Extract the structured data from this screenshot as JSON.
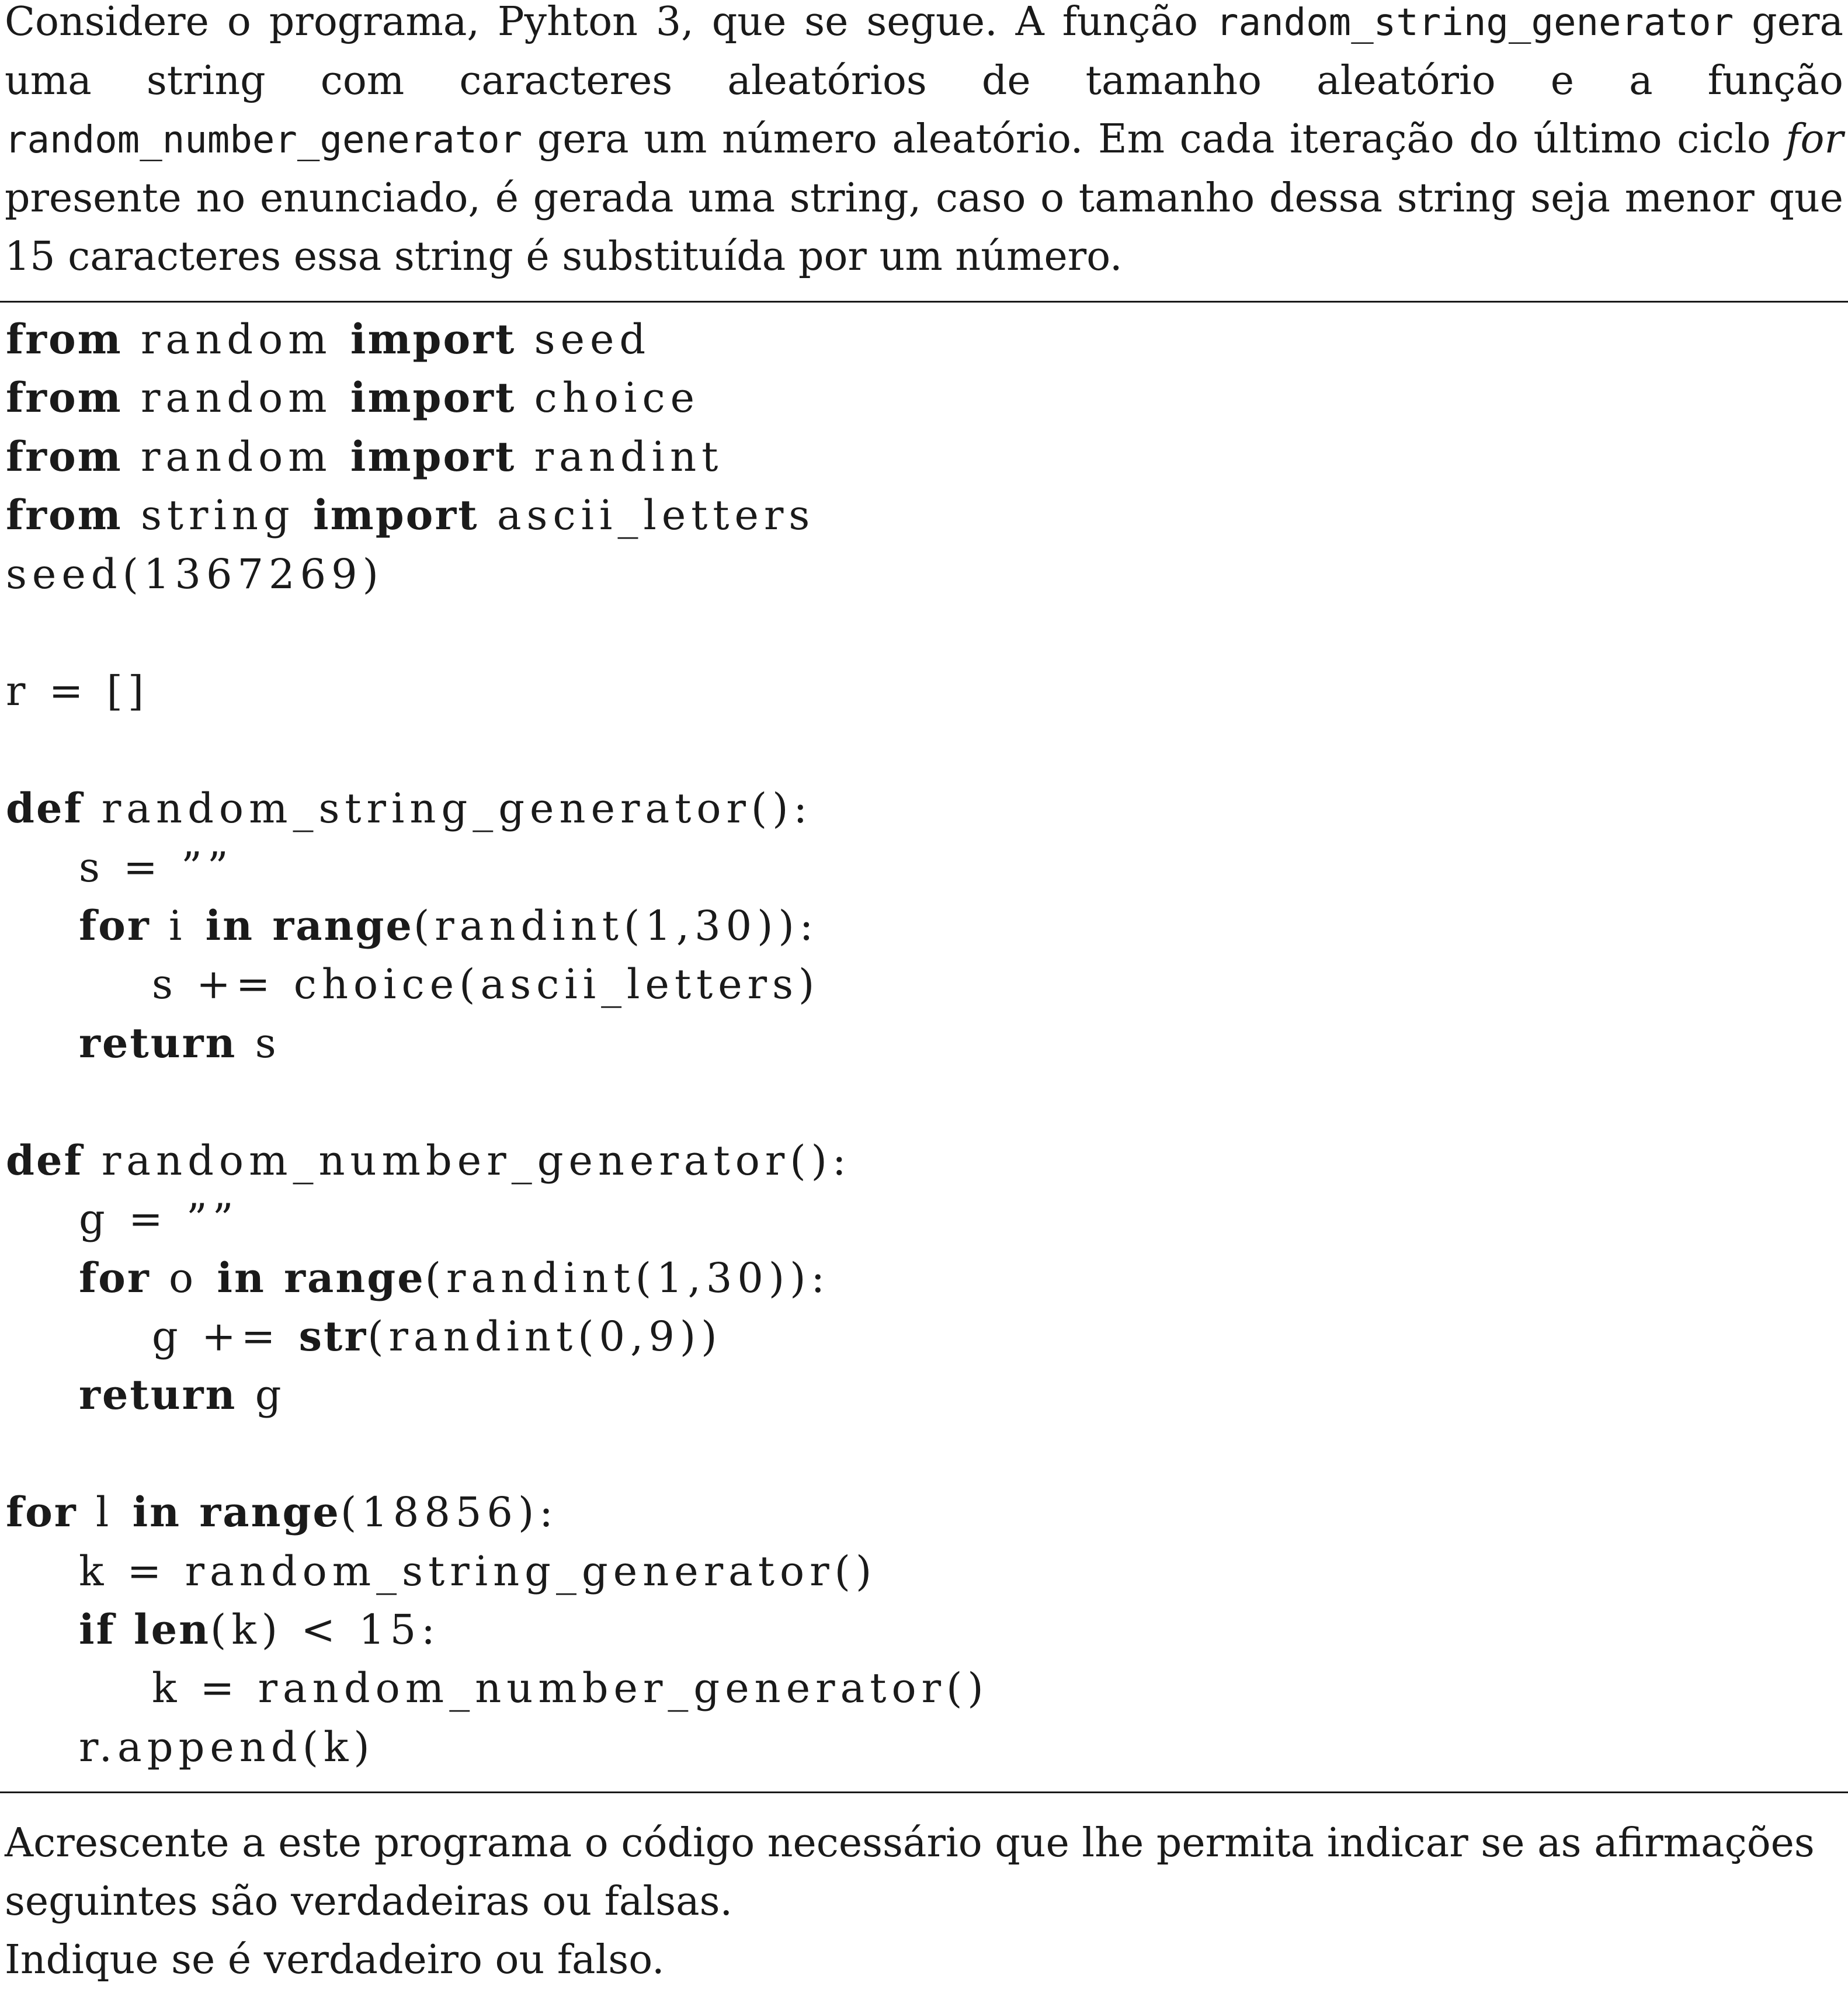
{
  "intro": {
    "text_1": "Considere o programa, Pyhton 3, que se segue.  A função ",
    "func_1": "random_string_generator",
    "text_2": " gera uma string com caracteres aleatórios de tamanho aleatório e a função ",
    "func_2": "random_number_generator",
    "text_3": " gera um número aleatório. Em cada iteração do último ciclo ",
    "for_word": "for",
    "text_4": " presente no enunciado, é gerada uma string, caso o tamanho dessa string seja menor que 15 caracteres essa string é substituída por um número."
  },
  "code": {
    "lines": [
      [
        {
          "t": "from",
          "k": true
        },
        {
          "t": " random "
        },
        {
          "t": "import",
          "k": true
        },
        {
          "t": " seed"
        }
      ],
      [
        {
          "t": "from",
          "k": true
        },
        {
          "t": " random "
        },
        {
          "t": "import",
          "k": true
        },
        {
          "t": " choice"
        }
      ],
      [
        {
          "t": "from",
          "k": true
        },
        {
          "t": " random "
        },
        {
          "t": "import",
          "k": true
        },
        {
          "t": " randint"
        }
      ],
      [
        {
          "t": "from",
          "k": true
        },
        {
          "t": " string "
        },
        {
          "t": "import",
          "k": true
        },
        {
          "t": " ascii_letters"
        }
      ],
      [
        {
          "t": "seed(1367269)"
        }
      ],
      [],
      [
        {
          "t": "r = []"
        }
      ],
      [],
      [
        {
          "t": "def",
          "k": true
        },
        {
          "t": " random_string_generator():"
        }
      ],
      [
        {
          "t": "    s = ””"
        }
      ],
      [
        {
          "t": "    "
        },
        {
          "t": "for",
          "k": true
        },
        {
          "t": " i "
        },
        {
          "t": "in",
          "k": true
        },
        {
          "t": " "
        },
        {
          "t": "range",
          "k": true
        },
        {
          "t": "(randint(1,30)):"
        }
      ],
      [
        {
          "t": "        s += choice(ascii_letters)"
        }
      ],
      [
        {
          "t": "    "
        },
        {
          "t": "return",
          "k": true
        },
        {
          "t": " s"
        }
      ],
      [],
      [
        {
          "t": "def",
          "k": true
        },
        {
          "t": " random_number_generator():"
        }
      ],
      [
        {
          "t": "    g = ””"
        }
      ],
      [
        {
          "t": "    "
        },
        {
          "t": "for",
          "k": true
        },
        {
          "t": " o "
        },
        {
          "t": "in",
          "k": true
        },
        {
          "t": " "
        },
        {
          "t": "range",
          "k": true
        },
        {
          "t": "(randint(1,30)):"
        }
      ],
      [
        {
          "t": "        g += "
        },
        {
          "t": "str",
          "k": true
        },
        {
          "t": "(randint(0,9))"
        }
      ],
      [
        {
          "t": "    "
        },
        {
          "t": "return",
          "k": true
        },
        {
          "t": " g"
        }
      ],
      [],
      [
        {
          "t": "for",
          "k": true
        },
        {
          "t": " l "
        },
        {
          "t": "in",
          "k": true
        },
        {
          "t": " "
        },
        {
          "t": "range",
          "k": true
        },
        {
          "t": "(18856):"
        }
      ],
      [
        {
          "t": "    k = random_string_generator()"
        }
      ],
      [
        {
          "t": "    "
        },
        {
          "t": "if",
          "k": true
        },
        {
          "t": " "
        },
        {
          "t": "len",
          "k": true
        },
        {
          "t": "(k) < 15:"
        }
      ],
      [
        {
          "t": "        k = random_number_generator()"
        }
      ],
      [
        {
          "t": "    r.append(k)"
        }
      ]
    ]
  },
  "closing": {
    "line_1": "Acrescente a este programa o código necessário que lhe permita indicar se as afirmações seguintes são verdadeiras ou falsas.",
    "line_2": "Indique se é verdadeiro ou falso."
  }
}
